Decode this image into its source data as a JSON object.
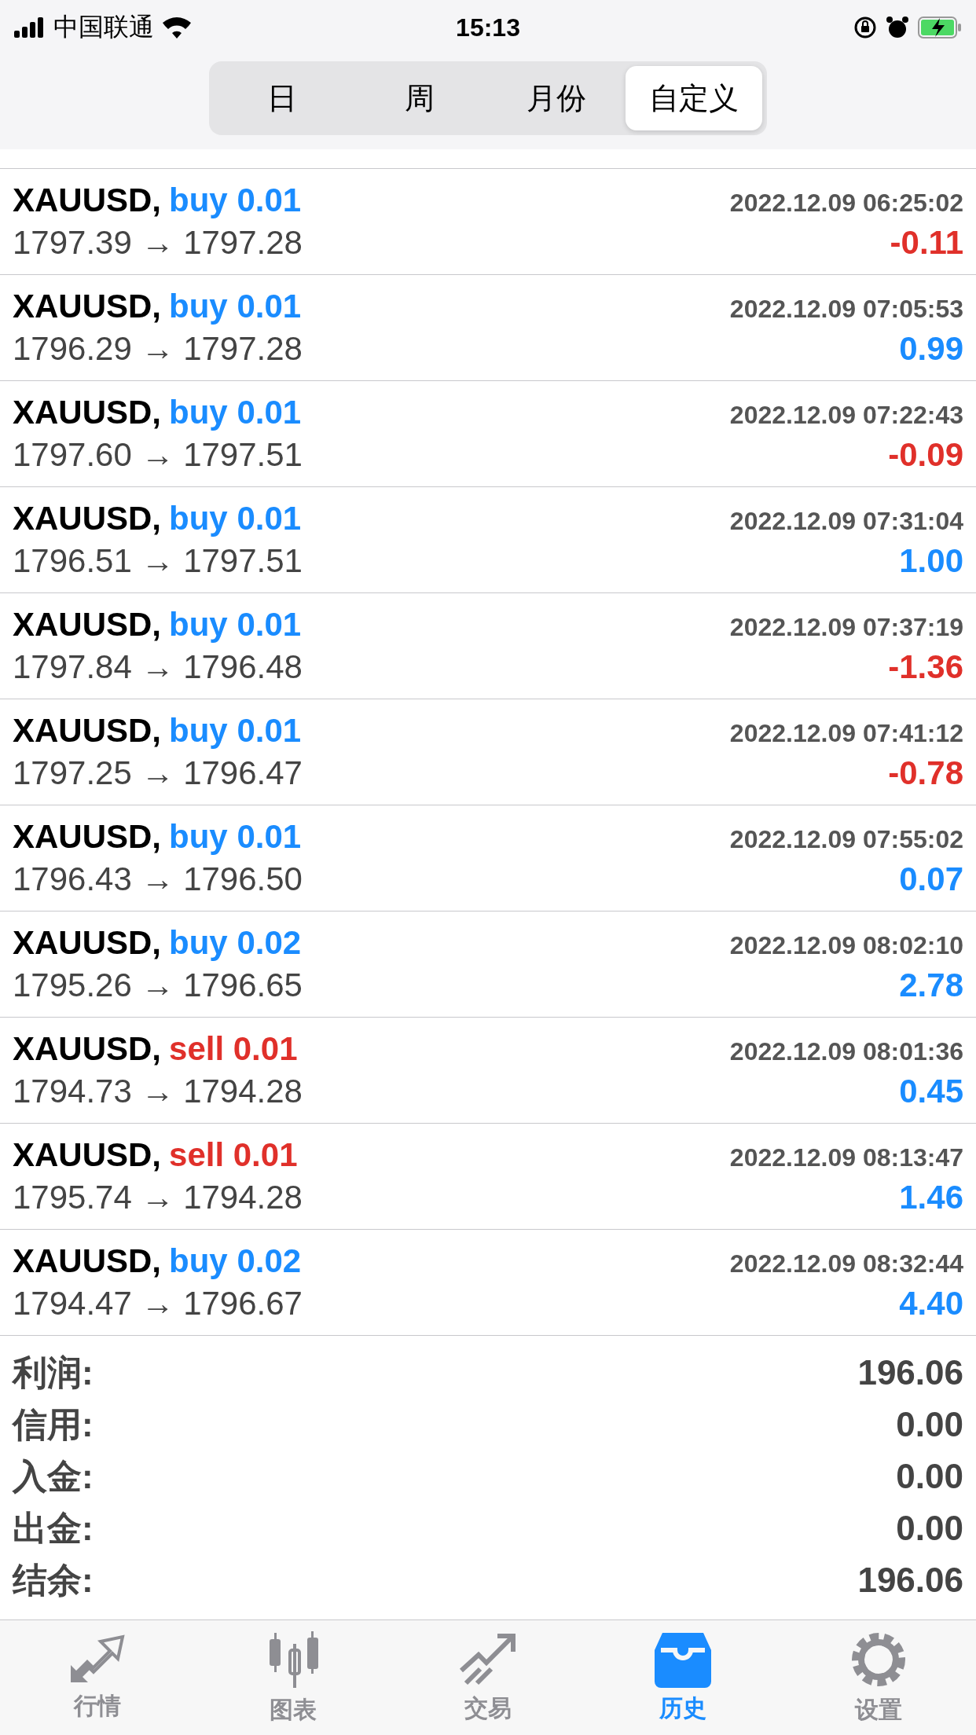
{
  "status_bar": {
    "carrier": "中国联通",
    "time": "15:13"
  },
  "period_tabs": [
    {
      "label": "日",
      "selected": false
    },
    {
      "label": "周",
      "selected": false
    },
    {
      "label": "月份",
      "selected": false
    },
    {
      "label": "自定义",
      "selected": true
    }
  ],
  "trades": [
    {
      "symbol": "XAUUSD,",
      "kind": "buy",
      "side": "buy",
      "volume": "0.01",
      "time": "2022.12.09 06:25:02",
      "prices": "1797.39 → 1797.28",
      "profit": "-0.11",
      "negative": true
    },
    {
      "symbol": "XAUUSD,",
      "kind": "buy",
      "side": "buy",
      "volume": "0.01",
      "time": "2022.12.09 07:05:53",
      "prices": "1796.29 → 1797.28",
      "profit": "0.99",
      "negative": false
    },
    {
      "symbol": "XAUUSD,",
      "kind": "buy",
      "side": "buy",
      "volume": "0.01",
      "time": "2022.12.09 07:22:43",
      "prices": "1797.60 → 1797.51",
      "profit": "-0.09",
      "negative": true
    },
    {
      "symbol": "XAUUSD,",
      "kind": "buy",
      "side": "buy",
      "volume": "0.01",
      "time": "2022.12.09 07:31:04",
      "prices": "1796.51 → 1797.51",
      "profit": "1.00",
      "negative": false
    },
    {
      "symbol": "XAUUSD,",
      "kind": "buy",
      "side": "buy",
      "volume": "0.01",
      "time": "2022.12.09 07:37:19",
      "prices": "1797.84 → 1796.48",
      "profit": "-1.36",
      "negative": true
    },
    {
      "symbol": "XAUUSD,",
      "kind": "buy",
      "side": "buy",
      "volume": "0.01",
      "time": "2022.12.09 07:41:12",
      "prices": "1797.25 → 1796.47",
      "profit": "-0.78",
      "negative": true
    },
    {
      "symbol": "XAUUSD,",
      "kind": "buy",
      "side": "buy",
      "volume": "0.01",
      "time": "2022.12.09 07:55:02",
      "prices": "1796.43 → 1796.50",
      "profit": "0.07",
      "negative": false
    },
    {
      "symbol": "XAUUSD,",
      "kind": "buy",
      "side": "buy",
      "volume": "0.02",
      "time": "2022.12.09 08:02:10",
      "prices": "1795.26 → 1796.65",
      "profit": "2.78",
      "negative": false
    },
    {
      "symbol": "XAUUSD,",
      "kind": "sell",
      "side": "sell",
      "volume": "0.01",
      "time": "2022.12.09 08:01:36",
      "prices": "1794.73 → 1794.28",
      "profit": "0.45",
      "negative": false
    },
    {
      "symbol": "XAUUSD,",
      "kind": "sell",
      "side": "sell",
      "volume": "0.01",
      "time": "2022.12.09 08:13:47",
      "prices": "1795.74 → 1794.28",
      "profit": "1.46",
      "negative": false
    },
    {
      "symbol": "XAUUSD,",
      "kind": "buy",
      "side": "buy",
      "volume": "0.02",
      "time": "2022.12.09 08:32:44",
      "prices": "1794.47 → 1796.67",
      "profit": "4.40",
      "negative": false
    }
  ],
  "summary": [
    {
      "label": "利润:",
      "value": "196.06"
    },
    {
      "label": "信用:",
      "value": "0.00"
    },
    {
      "label": "入金:",
      "value": "0.00"
    },
    {
      "label": "出金:",
      "value": "0.00"
    },
    {
      "label": "结余:",
      "value": "196.06"
    }
  ],
  "tab_bar": [
    {
      "kind": "quotes",
      "label": "行情",
      "selected": false
    },
    {
      "kind": "chart",
      "label": "图表",
      "selected": false
    },
    {
      "kind": "trade",
      "label": "交易",
      "selected": false
    },
    {
      "kind": "history",
      "label": "历史",
      "selected": true
    },
    {
      "kind": "settings",
      "label": "设置",
      "selected": false
    }
  ]
}
